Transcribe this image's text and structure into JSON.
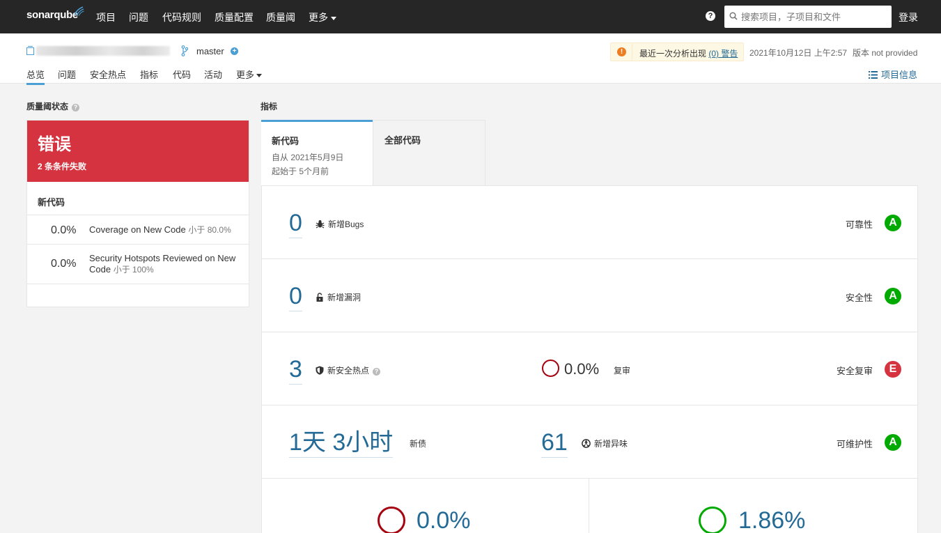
{
  "topnav": {
    "logo": "sonarqube",
    "items": [
      "项目",
      "问题",
      "代码规则",
      "质量配置",
      "质量阈",
      "更多"
    ],
    "search_placeholder": "搜索项目，子项目和文件",
    "login": "登录"
  },
  "project": {
    "branch": "master",
    "warning_text": "最近一次分析出现",
    "warning_link": "(0) 警告",
    "analysis_date": "2021年10月12日 上午2:57",
    "version": "版本 not provided",
    "tabs": [
      "总览",
      "问题",
      "安全热点",
      "指标",
      "代码",
      "活动",
      "更多"
    ],
    "info_link": "项目信息"
  },
  "quality_gate": {
    "title": "质量阈状态",
    "status": "错误",
    "failed_conditions": "2 条条件失败",
    "section": "新代码",
    "conditions": [
      {
        "value": "0.0%",
        "label": "Coverage on New Code",
        "threshold": "小于 80.0%"
      },
      {
        "value": "0.0%",
        "label": "Security Hotspots Reviewed on New Code",
        "threshold": "小于 100%"
      }
    ]
  },
  "metrics": {
    "title": "指标",
    "tab_new": {
      "label": "新代码",
      "since": "自从 2021年5月9日",
      "started": "起始于 5个月前"
    },
    "tab_all": {
      "label": "全部代码"
    },
    "bugs": {
      "value": "0",
      "label": "新增Bugs",
      "rating_label": "可靠性",
      "rating": "A"
    },
    "vulnerabilities": {
      "value": "0",
      "label": "新增漏洞",
      "rating_label": "安全性",
      "rating": "A"
    },
    "hotspots": {
      "value": "3",
      "label": "新安全热点",
      "reviewed": "0.0%",
      "reviewed_label": "复审",
      "rating_label": "安全复审",
      "rating": "E"
    },
    "debt": {
      "value": "1天 3小时",
      "label": "新债",
      "smells": "61",
      "smells_label": "新增异味",
      "rating_label": "可维护性",
      "rating": "A"
    },
    "coverage": {
      "value": "0.0%"
    },
    "duplications": {
      "value": "1.86%"
    }
  },
  "colors": {
    "accent": "#4b9fd5",
    "error": "#d4333f",
    "rating_a": "#00aa00",
    "link": "#236a97"
  }
}
